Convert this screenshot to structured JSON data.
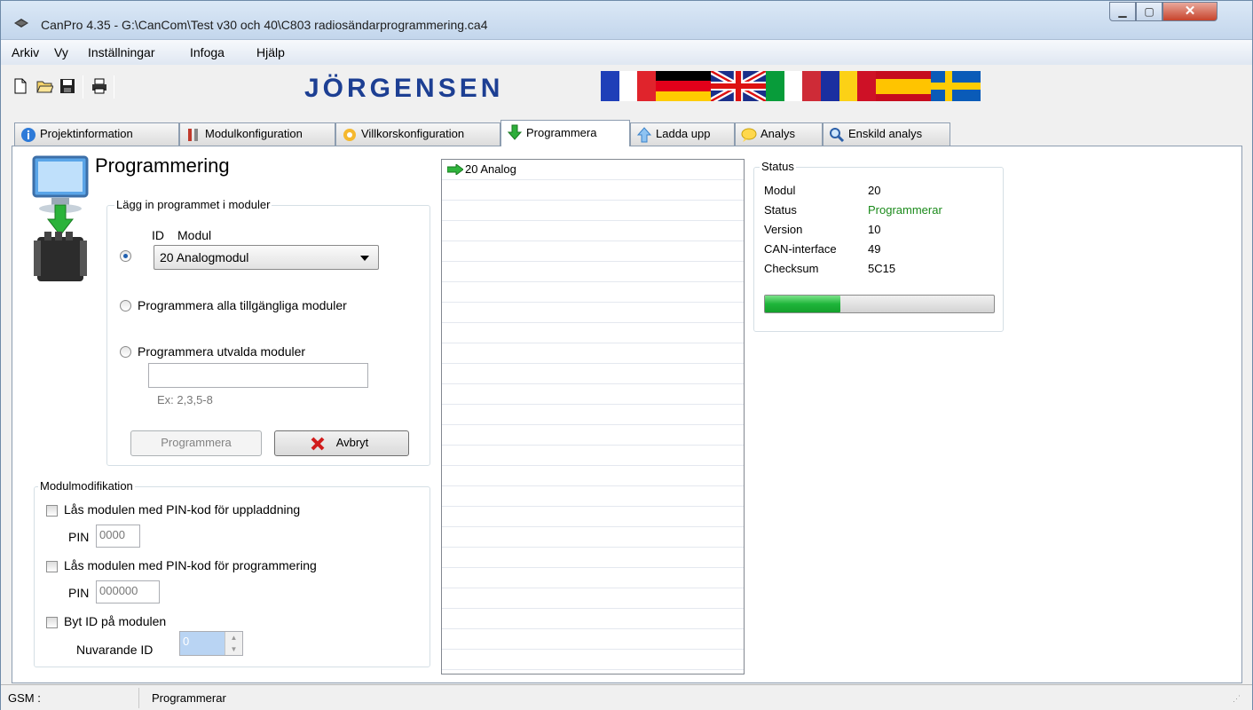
{
  "window": {
    "title": "CanPro 4.35 - G:\\CanCom\\Test v30 och 40\\C803 radiosändarprogrammering.ca4",
    "controls": [
      "minimize",
      "maximize",
      "close"
    ]
  },
  "menu": [
    "Arkiv",
    "Vy",
    "Inställningar",
    "Infoga",
    "Hjälp"
  ],
  "toolbar": {
    "brand": "JÖRGENSEN",
    "icons": [
      "new-file-icon",
      "open-folder-icon",
      "save-icon",
      "print-icon"
    ],
    "flags": [
      "french-flag",
      "german-flag",
      "uk-flag",
      "italian-flag",
      "romanian-flag",
      "spanish-flag",
      "swedish-flag"
    ]
  },
  "tabs": [
    {
      "label": "Projektinformation",
      "icon": "info-icon"
    },
    {
      "label": "Modulkonfiguration",
      "icon": "module-icon"
    },
    {
      "label": "Villkorskonfiguration",
      "icon": "condition-icon"
    },
    {
      "label": "Programmera",
      "icon": "download-arrow-icon",
      "active": true
    },
    {
      "label": "Ladda upp",
      "icon": "upload-arrow-icon"
    },
    {
      "label": "Analys",
      "icon": "analysis-icon"
    },
    {
      "label": "Enskild analys",
      "icon": "magnifier-icon"
    }
  ],
  "programmering": {
    "title": "Programmering",
    "group_label": "Lägg in programmet i moduler",
    "col_id": "ID",
    "col_modul": "Modul",
    "selected_module": "20 Analogmodul",
    "option_all": "Programmera alla tillgängliga moduler",
    "option_selected": "Programmera utvalda moduler",
    "selected_input": "",
    "example": "Ex: 2,3,5-8",
    "btn_program": "Programmera",
    "btn_cancel": "Avbryt"
  },
  "modulmodifikation": {
    "label": "Modulmodifikation",
    "lock_upload": "Lås modulen med PIN-kod för uppladdning",
    "pin_label": "PIN",
    "pin_upload": "0000",
    "lock_program": "Lås modulen med PIN-kod för programmering",
    "pin_program": "000000",
    "change_id": "Byt ID på modulen",
    "current_id_label": "Nuvarande ID",
    "current_id": "0"
  },
  "list": {
    "items": [
      "20 Analog"
    ]
  },
  "status": {
    "label": "Status",
    "rows": [
      {
        "key": "Modul",
        "value": "20"
      },
      {
        "key": "Status",
        "value": "Programmerar"
      },
      {
        "key": "Version",
        "value": "10"
      },
      {
        "key": "CAN-interface",
        "value": "49"
      },
      {
        "key": "Checksum",
        "value": "5C15"
      }
    ],
    "progress": 0.33,
    "status_color": "#1a8a1a"
  },
  "statusbar": {
    "gsm": "GSM :",
    "text": "Programmerar"
  }
}
